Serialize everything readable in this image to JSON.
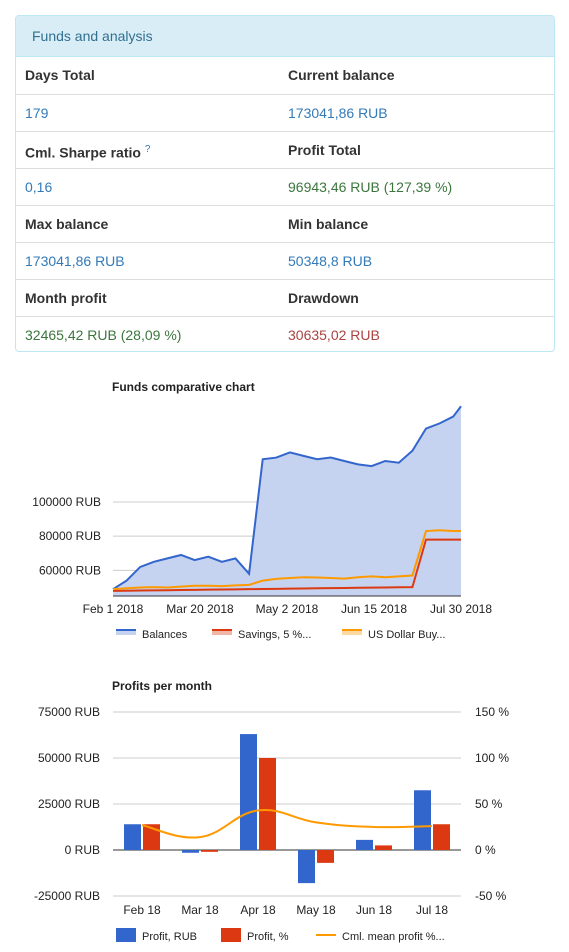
{
  "panel": {
    "title": "Funds and analysis",
    "rows": [
      {
        "left_label": "Days Total",
        "right_label": "Current balance"
      },
      {
        "left_value": "179",
        "right_value": "173041,86 RUB"
      },
      {
        "left_label": "Cml. Sharpe ratio",
        "left_help": "?",
        "right_label": "Profit Total"
      },
      {
        "left_value": "0,16",
        "right_value": "96943,46 RUB (127,39 %)"
      },
      {
        "left_label": "Max balance",
        "right_label": "Min balance"
      },
      {
        "left_value": "173041,86 RUB",
        "right_value": "50348,8 RUB"
      },
      {
        "left_label": "Month profit",
        "right_label": "Drawdown"
      },
      {
        "left_value": "32465,42 RUB (28,09 %)",
        "right_value": "30635,02 RUB"
      }
    ]
  },
  "colors": {
    "balances": "#3366cc",
    "savings": "#dc3912",
    "usd": "#ff9900",
    "panel_bg": "#d9edf7",
    "value_blue": "#337ab7",
    "value_green": "#3c763d",
    "value_red": "#a94442"
  },
  "chart_data": [
    {
      "type": "area",
      "title": "Funds comparative chart",
      "x_labels": [
        "Feb 1 2018",
        "Mar 20 2018",
        "May 2 2018",
        "Jun 15 2018",
        "Jul 30 2018"
      ],
      "y_tick_labels": [
        "100000 RUB",
        "80000 RUB",
        "60000 RUB"
      ],
      "y_ticks": [
        100000,
        80000,
        60000
      ],
      "ylim": [
        45000,
        155000
      ],
      "x": [
        "2018-02-01",
        "2018-02-08",
        "2018-02-15",
        "2018-02-22",
        "2018-03-01",
        "2018-03-08",
        "2018-03-15",
        "2018-03-22",
        "2018-03-29",
        "2018-04-05",
        "2018-04-12",
        "2018-04-19",
        "2018-04-26",
        "2018-05-03",
        "2018-05-10",
        "2018-05-17",
        "2018-05-24",
        "2018-05-31",
        "2018-06-07",
        "2018-06-14",
        "2018-06-21",
        "2018-06-28",
        "2018-07-05",
        "2018-07-12",
        "2018-07-19",
        "2018-07-26",
        "2018-07-30"
      ],
      "series": [
        {
          "name": "Balances",
          "values": [
            49000,
            54000,
            62000,
            65000,
            67000,
            69000,
            66000,
            68000,
            65000,
            67000,
            58000,
            125000,
            126000,
            129000,
            127000,
            125000,
            126000,
            124000,
            122000,
            121000,
            124000,
            123000,
            130000,
            143000,
            146000,
            150000,
            156000
          ]
        },
        {
          "name": "Savings, 5 %...",
          "values": [
            48000,
            48100,
            48200,
            48300,
            48400,
            48500,
            48600,
            48700,
            48800,
            48900,
            49000,
            49100,
            49200,
            49300,
            49400,
            49500,
            49600,
            49700,
            49800,
            49900,
            50000,
            50100,
            50200,
            78000,
            78000,
            78000,
            78000
          ]
        },
        {
          "name": "US Dollar Buy...",
          "values": [
            49000,
            49500,
            50000,
            50200,
            50000,
            50500,
            51000,
            51000,
            50800,
            51200,
            51500,
            54000,
            55000,
            55500,
            56000,
            55800,
            55500,
            55200,
            56000,
            56500,
            56000,
            56500,
            57000,
            83000,
            83500,
            83000,
            83000
          ]
        }
      ],
      "legend": [
        "Balances",
        "Savings, 5 %...",
        "US Dollar Buy..."
      ],
      "legend_position": "bottom"
    },
    {
      "type": "bar",
      "title": "Profits per month",
      "categories": [
        "Feb 18",
        "Mar 18",
        "Apr 18",
        "May 18",
        "Jun 18",
        "Jul 18"
      ],
      "left_axis": {
        "ticks": [
          75000,
          50000,
          25000,
          0,
          -25000
        ],
        "tick_labels": [
          "75000 RUB",
          "50000 RUB",
          "25000 RUB",
          "0 RUB",
          "-25000 RUB"
        ],
        "ylim": [
          -25000,
          75000
        ]
      },
      "right_axis": {
        "ticks": [
          150,
          100,
          50,
          0,
          -50
        ],
        "tick_labels": [
          "150 %",
          "100 %",
          "50 %",
          "0 %",
          "-50 %"
        ],
        "ylim": [
          -50,
          150
        ]
      },
      "series": [
        {
          "name": "Profit, RUB",
          "axis": "left",
          "values": [
            14000,
            -1500,
            63000,
            -18000,
            5500,
            32465
          ]
        },
        {
          "name": "Profit, %",
          "axis": "right",
          "values": [
            28,
            -2,
            100,
            -14,
            5,
            28
          ]
        },
        {
          "name": "Cml. mean profit %...",
          "axis": "right",
          "type": "line",
          "values": [
            27,
            14,
            43,
            30,
            25,
            26
          ]
        }
      ],
      "legend": [
        "Profit, RUB",
        "Profit, %",
        "Cml. mean profit %..."
      ],
      "legend_position": "bottom"
    }
  ]
}
